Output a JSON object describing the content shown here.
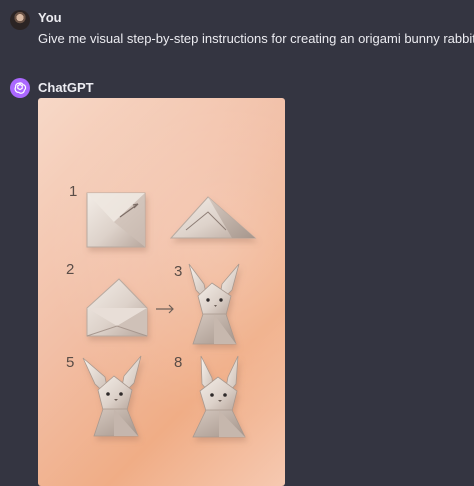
{
  "user_message": {
    "author": "You",
    "text": "Give me visual step-by-step instructions for creating an origami bunny rabbit"
  },
  "assistant_message": {
    "author": "ChatGPT",
    "image": {
      "steps": [
        "1",
        "2",
        "3",
        "5",
        "8"
      ]
    }
  },
  "colors": {
    "background": "#343541",
    "text": "#ececf1",
    "assistant_avatar": "#ab68ff",
    "image_peach": "#f2bfa6",
    "paper": "#e5ddd5"
  },
  "icons": [
    "user-avatar",
    "chatgpt-logo-icon",
    "right-arrow-icon"
  ]
}
